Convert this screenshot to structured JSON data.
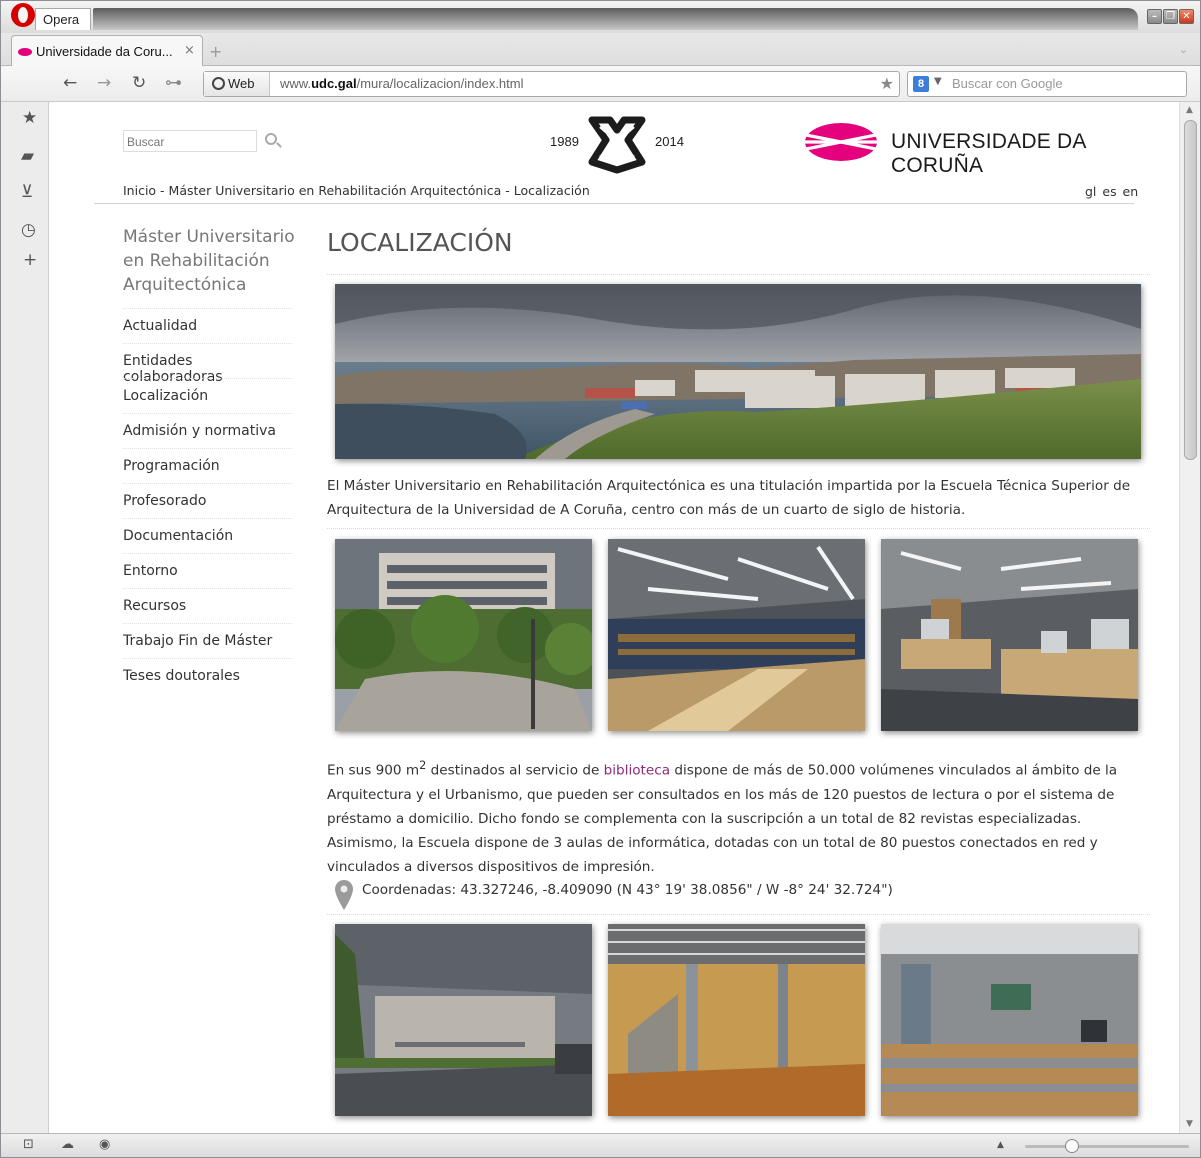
{
  "browser": {
    "app_name": "Opera",
    "tab_title": "Universidade da Coru...",
    "tab_close": "×",
    "new_tab": "+",
    "address": {
      "badge": "Web",
      "url_prefix": "www.",
      "url_domain": "udc.gal",
      "url_path": "/mura/localizacion/index.html"
    },
    "search_placeholder": "Buscar con Google",
    "search_engine_badge": "8"
  },
  "site": {
    "search_placeholder": "Buscar",
    "anniversary": {
      "start": "1989",
      "end": "2014"
    },
    "university_name": "UNIVERSIDADE DA CORUÑA",
    "brand_color": "#e5007e",
    "breadcrumb": "Inicio - Máster Universitario en Rehabilitación Arquitectónica - Localización",
    "languages": "gl es en"
  },
  "sidebar": {
    "title": "Máster Universitario en Rehabilitación Arquitectónica",
    "items": [
      {
        "label": "Actualidad"
      },
      {
        "label": "Entidades colaboradoras"
      },
      {
        "label": "Localización"
      },
      {
        "label": "Admisión y normativa"
      },
      {
        "label": "Programación"
      },
      {
        "label": "Profesorado"
      },
      {
        "label": "Documentación"
      },
      {
        "label": "Entorno"
      },
      {
        "label": "Recursos"
      },
      {
        "label": "Trabajo Fin de Máster"
      },
      {
        "label": "Teses doutorales"
      }
    ]
  },
  "main": {
    "title": "LOCALIZACIÓN",
    "intro": "El Máster Universitario en Rehabilitación Arquitectónica es una titulación impartida por la Escuela Técnica Superior de Arquitectura de la Universidad de A Coruña, centro con más de un cuarto de siglo de historia.",
    "library": {
      "before_sup": "En sus 900 m",
      "sup": "2",
      "before_link": " destinados al servicio de ",
      "link": "biblioteca",
      "after_link": " dispone de más de 50.000 volúmenes vinculados al ámbito de la Arquitectura y el Urbanismo, que pueden ser consultados en los más de 120 puestos de lectura o por el sistema de préstamo a domicilio. Dicho fondo se complementa con la suscripción a un total de 82 revistas especializadas. Asimismo, la Escuela dispone de 3 aulas de informática, dotadas con un total de 80 puestos conectados en red y vinculados a diversos dispositivos de impresión."
    },
    "coordinates": "Coordenadas: 43.327246, -8.409090 (N 43° 19' 38.0856\" / W -8° 24' 32.724\")"
  }
}
